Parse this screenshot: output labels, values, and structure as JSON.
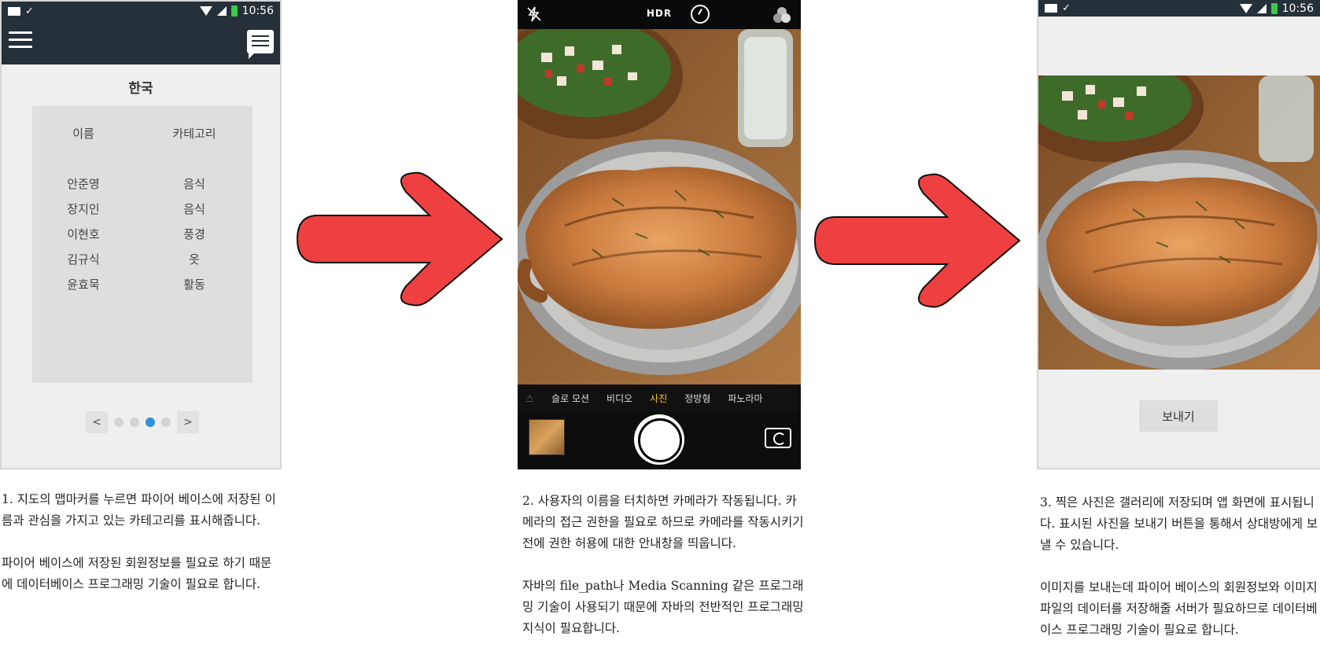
{
  "status_bar": {
    "time": "10:56"
  },
  "screen1": {
    "title": "한국",
    "table": {
      "headers": [
        "이름",
        "카테고리"
      ],
      "rows": [
        [
          "안준영",
          "음식"
        ],
        [
          "장지인",
          "음식"
        ],
        [
          "이현호",
          "풍경"
        ],
        [
          "김규식",
          "옷"
        ],
        [
          "윤효묵",
          "활동"
        ]
      ]
    },
    "pager": {
      "prev": "<",
      "next": ">",
      "page_count": 4,
      "active_page": 3
    }
  },
  "screen2": {
    "hdr_label": "HDR",
    "modes": [
      "스",
      "슬로 모션",
      "비디오",
      "사진",
      "정방형",
      "파노라마"
    ],
    "selected_mode": "사진"
  },
  "screen3": {
    "send_button": "보내기"
  },
  "captions": {
    "step1": {
      "p1": "1. 지도의 맵마커를 누르면 파이어 베이스에 저장된 이름과 관심을 가지고 있는 카테고리를 표시해줍니다.",
      "p2": "파이어 베이스에 저장된 회원정보를 필요로 하기 때문에 데이터베이스 프로그래밍 기술이 필요로 합니다."
    },
    "step2": {
      "p1": "2. 사용자의 이름을 터치하면 카메라가 작동됩니다. 카메라의 접근 권한을 필요로 하므로 카메라를 작동시키기 전에 권한 허용에 대한 안내창을 띄웁니다.",
      "p2": "자바의 file_path나 Media Scanning 같은 프로그래밍 기술이 사용되기 때문에 자바의 전반적인 프로그래밍 지식이 필요합니다."
    },
    "step3": {
      "p1": "3. 찍은 사진은 갤러리에 저장되며 앱 화면에 표시됩니다. 표시된 사진을 보내기 버튼을 통해서 상대방에게 보낼 수 있습니다.",
      "p2": "이미지를 보내는데 파이어 베이스의 회원정보와 이미지 파일의 데이터를 저장해줄 서버가 필요하므로 데이터베이스 프로그래밍 기술이 필요로 합니다."
    }
  },
  "colors": {
    "app_bar": "#253038",
    "arrow": "#ee4040",
    "pager_active": "#2f8fd8",
    "camera_selected_mode": "#f5c03a"
  },
  "icons": [
    "mail-icon",
    "check-icon",
    "wifi-icon",
    "signal-icon",
    "battery-icon",
    "hamburger-menu-icon",
    "chat-icon",
    "flash-off-icon",
    "timer-icon",
    "filters-icon",
    "shutter-button",
    "switch-camera-icon",
    "right-arrow-graphic"
  ]
}
